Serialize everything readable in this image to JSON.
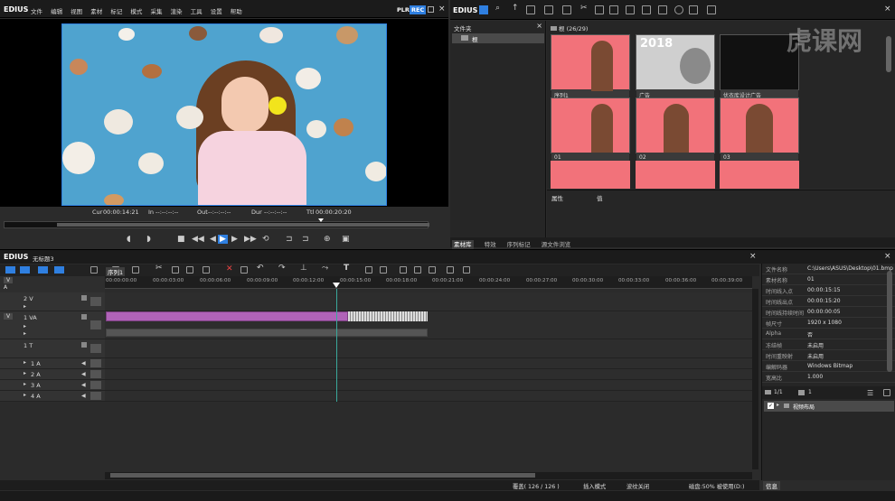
{
  "player": {
    "logo": "EDIUS",
    "menu": [
      "文件",
      "编辑",
      "视图",
      "素材",
      "标记",
      "模式",
      "采集",
      "渲染",
      "工具",
      "设置",
      "帮助"
    ],
    "mode_plr": "PLR",
    "mode_rec": "REC",
    "cur_label": "Cur",
    "cur_value": "00:00:14:21",
    "in_label": "In",
    "in_value": "--:--:--:--",
    "out_label": "Out",
    "out_value": "--:--:--:--",
    "dur_label": "Dur",
    "dur_value": "--:--:--:--",
    "ttl_label": "Ttl",
    "ttl_value": "00:00:20:20"
  },
  "bin": {
    "logo": "EDIUS",
    "folder_header": "文件夹",
    "root_folder": "根",
    "path_label": "根 (26/29)",
    "prop_col1": "属性",
    "prop_col2": "值",
    "tabs": [
      "素材库",
      "特效",
      "序列标记",
      "源文件浏览"
    ],
    "clips": [
      {
        "label": "序列1"
      },
      {
        "label": "广告"
      },
      {
        "label": "优衣库设计广告"
      },
      {
        "label": "01"
      },
      {
        "label": "02"
      },
      {
        "label": "03"
      },
      {
        "label": ""
      },
      {
        "label": ""
      },
      {
        "label": ""
      }
    ],
    "ad_text": "2018",
    "watermark": "虎课网"
  },
  "timeline": {
    "logo": "EDIUS",
    "project": "无标题3",
    "sequence_tab": "序列1",
    "ruler": [
      "00:00:00:00",
      "00:00:03:00",
      "00:00:06:00",
      "00:00:09:00",
      "00:00:12:00",
      "00:00:15:00",
      "00:00:18:00",
      "00:00:21:00",
      "00:00:24:00",
      "00:00:27:00",
      "00:00:30:00",
      "00:00:33:00",
      "00:00:36:00",
      "00:00:39:00"
    ],
    "tracks": [
      {
        "name": "2 V",
        "tag": "V"
      },
      {
        "name": "1 VA",
        "tag": "V"
      },
      {
        "name": "1 T",
        "tag": ""
      },
      {
        "name": "1 A",
        "tag": ""
      },
      {
        "name": "2 A",
        "tag": ""
      },
      {
        "name": "3 A",
        "tag": ""
      },
      {
        "name": "4 A",
        "tag": ""
      }
    ],
    "track_top_a": "A",
    "track_top_v": "V",
    "status": {
      "overwrite": "覆盖( 126 / 126 )",
      "insert": "插入模式",
      "ripple": "波纹关闭",
      "disk": "磁盘:50% 被使用(D:)"
    }
  },
  "info": {
    "rows": [
      {
        "k": "文件名称",
        "v": "C:\\Users\\ASUS\\Desktop\\01.bmp"
      },
      {
        "k": "素材名称",
        "v": "01"
      },
      {
        "k": "时间线入点",
        "v": "00:00:15:15"
      },
      {
        "k": "时间线出点",
        "v": "00:00:15:20"
      },
      {
        "k": "时间线持续时间",
        "v": "00:00:00:05"
      },
      {
        "k": "帧尺寸",
        "v": "1920 x 1080"
      },
      {
        "k": "Alpha",
        "v": "否"
      },
      {
        "k": "冻结帧",
        "v": "未启用"
      },
      {
        "k": "时间重映射",
        "v": "未启用"
      },
      {
        "k": "编解码器",
        "v": "Windows Bitmap"
      },
      {
        "k": "宽高比",
        "v": "1.000"
      }
    ],
    "page": "1/1",
    "count": "1",
    "effect": "视频布局",
    "tab": "信息"
  },
  "colors": {
    "accent": "#2f7fe0",
    "clip_v": "#b063b8",
    "clip_a": "#6b6b6b",
    "bg": "#2b2b2b"
  }
}
